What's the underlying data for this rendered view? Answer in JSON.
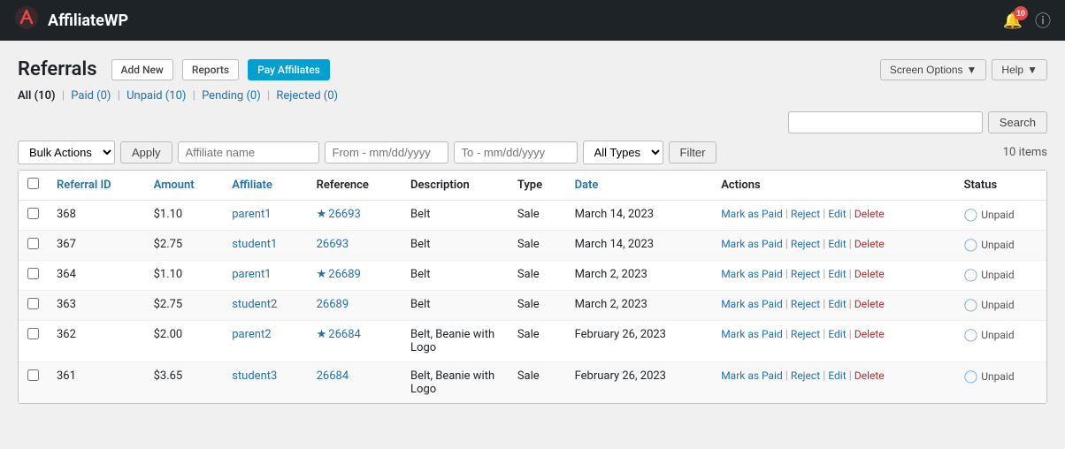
{
  "app": {
    "name": "AffiliateWP",
    "logo_icon": "✿",
    "notif_count": "10"
  },
  "header": {
    "screen_options_label": "Screen Options",
    "help_label": "Help"
  },
  "page": {
    "title": "Referrals",
    "add_new_label": "Add New",
    "reports_label": "Reports",
    "pay_affiliates_label": "Pay Affiliates"
  },
  "filter_tabs": [
    {
      "label": "All",
      "count": "(10)",
      "href": "#",
      "active": true
    },
    {
      "label": "Paid",
      "count": "(0)",
      "href": "#",
      "active": false
    },
    {
      "label": "Unpaid",
      "count": "(10)",
      "href": "#",
      "active": false
    },
    {
      "label": "Pending",
      "count": "(0)",
      "href": "#",
      "active": false
    },
    {
      "label": "Rejected",
      "count": "(0)",
      "href": "#",
      "active": false
    }
  ],
  "search": {
    "placeholder": "",
    "button_label": "Search"
  },
  "toolbar": {
    "bulk_actions_label": "Bulk Actions",
    "apply_label": "Apply",
    "affiliate_placeholder": "Affiliate name",
    "from_placeholder": "From - mm/dd/yyyy",
    "to_placeholder": "To - mm/dd/yyyy",
    "type_options": [
      "All Types"
    ],
    "filter_label": "Filter",
    "items_count": "10 items"
  },
  "table": {
    "columns": [
      {
        "key": "referral_id",
        "label": "Referral ID"
      },
      {
        "key": "amount",
        "label": "Amount"
      },
      {
        "key": "affiliate",
        "label": "Affiliate"
      },
      {
        "key": "reference",
        "label": "Reference"
      },
      {
        "key": "description",
        "label": "Description"
      },
      {
        "key": "type",
        "label": "Type"
      },
      {
        "key": "date",
        "label": "Date"
      },
      {
        "key": "actions",
        "label": "Actions"
      },
      {
        "key": "status",
        "label": "Status"
      }
    ],
    "rows": [
      {
        "id": "368",
        "amount": "$1.10",
        "affiliate": "parent1",
        "reference": "26693",
        "reference_starred": true,
        "description": "Belt",
        "type": "Sale",
        "date": "March 14, 2023",
        "status": "Unpaid"
      },
      {
        "id": "367",
        "amount": "$2.75",
        "affiliate": "student1",
        "reference": "26693",
        "reference_starred": false,
        "description": "Belt",
        "type": "Sale",
        "date": "March 14, 2023",
        "status": "Unpaid"
      },
      {
        "id": "364",
        "amount": "$1.10",
        "affiliate": "parent1",
        "reference": "26689",
        "reference_starred": true,
        "description": "Belt",
        "type": "Sale",
        "date": "March 2, 2023",
        "status": "Unpaid"
      },
      {
        "id": "363",
        "amount": "$2.75",
        "affiliate": "student2",
        "reference": "26689",
        "reference_starred": false,
        "description": "Belt",
        "type": "Sale",
        "date": "March 2, 2023",
        "status": "Unpaid"
      },
      {
        "id": "362",
        "amount": "$2.00",
        "affiliate": "parent2",
        "reference": "26684",
        "reference_starred": true,
        "description": "Belt, Beanie with Logo",
        "type": "Sale",
        "date": "February 26, 2023",
        "status": "Unpaid"
      },
      {
        "id": "361",
        "amount": "$3.65",
        "affiliate": "student3",
        "reference": "26684",
        "reference_starred": false,
        "description": "Belt, Beanie with Logo",
        "type": "Sale",
        "date": "February 26, 2023",
        "status": "Unpaid"
      }
    ],
    "actions": {
      "mark_as_paid": "Mark as Paid",
      "reject": "Reject",
      "edit": "Edit",
      "delete": "Delete"
    }
  }
}
